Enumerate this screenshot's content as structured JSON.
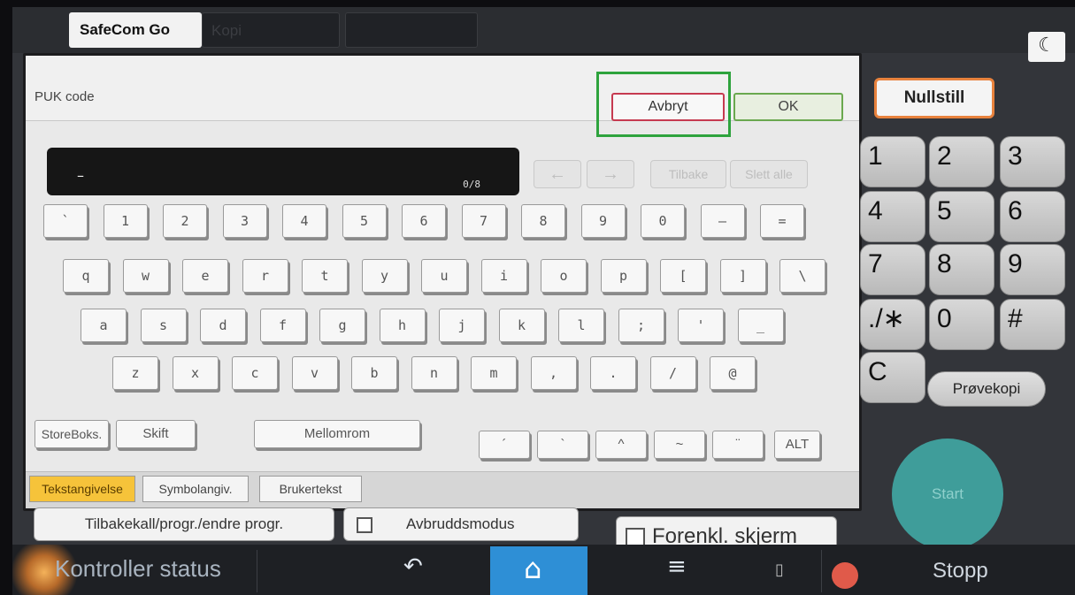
{
  "top_tabs": [
    "SafeCom Go",
    "Kopi"
  ],
  "dialog": {
    "field_title": "PUK code",
    "cancel_label": "Avbryt",
    "ok_label": "OK",
    "input_value": "–",
    "char_count": "0/8",
    "back_label": "Tilbake",
    "clear_all_label": "Slett alle",
    "left_arrow": "←",
    "right_arrow": "→"
  },
  "keyboard": {
    "row1": [
      "`",
      "1",
      "2",
      "3",
      "4",
      "5",
      "6",
      "7",
      "8",
      "9",
      "0",
      "–",
      "="
    ],
    "row2": [
      "q",
      "w",
      "e",
      "r",
      "t",
      "y",
      "u",
      "i",
      "o",
      "p",
      "[",
      "]",
      "\\"
    ],
    "row3": [
      "a",
      "s",
      "d",
      "f",
      "g",
      "h",
      "j",
      "k",
      "l",
      ";",
      "'",
      "_"
    ],
    "row4": [
      "z",
      "x",
      "c",
      "v",
      "b",
      "n",
      "m",
      ",",
      ".",
      "/",
      "@"
    ],
    "caps_label": "StoreBoks.",
    "shift_label": "Skift",
    "space_label": "Mellomrom",
    "accents": [
      "´",
      "`",
      "^",
      "~",
      "¨"
    ],
    "alt_label": "ALT"
  },
  "input_modes": [
    "Tekstangivelse",
    "Symbolangiv.",
    "Brukertekst"
  ],
  "lower": {
    "recall_label": "Tilbakekall/progr./endre progr.",
    "interrupt_label": "Avbruddsmodus",
    "simple_screen_label": "Forenkl. skjerm"
  },
  "keypad": {
    "reset_label": "Nullstill",
    "keys": [
      "1",
      "2",
      "3",
      "4",
      "5",
      "6",
      "7",
      "8",
      "9",
      "./∗",
      "0",
      "#",
      "C"
    ],
    "proof_label": "Prøvekopi",
    "start_label": "Start"
  },
  "status_bar": {
    "status_label": "Kontroller status",
    "stop_label": "Stopp",
    "back_icon": "↶",
    "home_icon": "⌂",
    "menu_icon": "≡"
  },
  "colors": {
    "cancel_border": "#c63a50",
    "ok_border": "#6aa84f",
    "annotation_box": "#2ea33d",
    "reset_border": "#e8823d",
    "active_mode": "#f6c33a",
    "start_button": "#3f9d9a",
    "home_tile": "#2e8fd6"
  }
}
